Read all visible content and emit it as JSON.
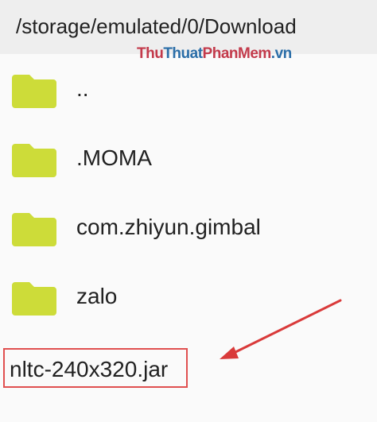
{
  "path_bar": {
    "path": "/storage/emulated/0/Download"
  },
  "watermark": {
    "part1": "Thu",
    "part2": "Thuat",
    "part3": "PhanMem",
    "part4": ".vn"
  },
  "folders": [
    {
      "name": "..",
      "icon": "folder-icon"
    },
    {
      "name": ".MOMA",
      "icon": "folder-icon"
    },
    {
      "name": "com.zhiyun.gimbal",
      "icon": "folder-icon"
    },
    {
      "name": "zalo",
      "icon": "folder-icon"
    }
  ],
  "file": {
    "name": "nltc-240x320.jar"
  },
  "colors": {
    "folder": "#cddc39",
    "highlight": "#e05050",
    "arrow": "#d93a3a"
  }
}
